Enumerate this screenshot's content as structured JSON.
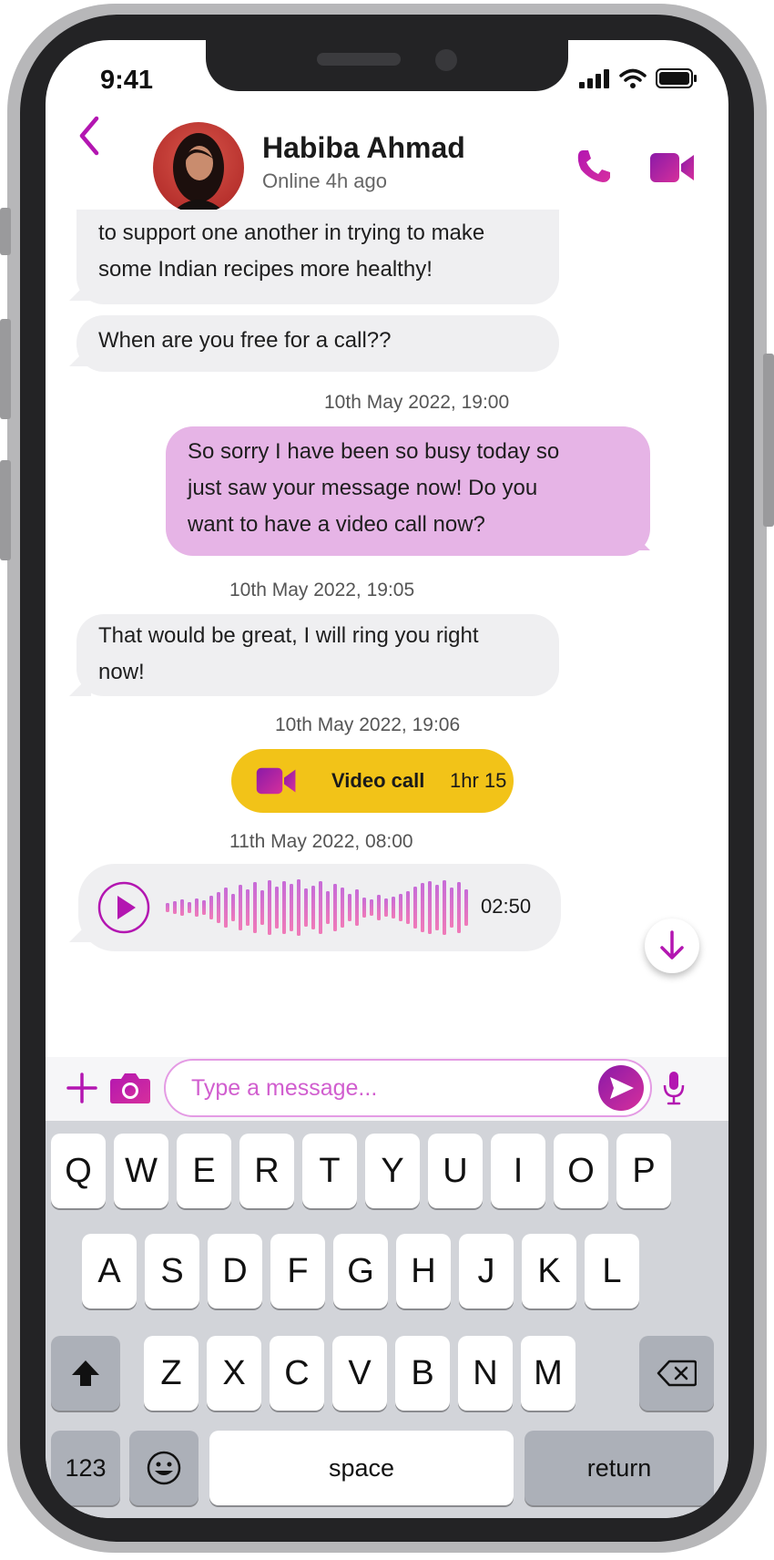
{
  "status_bar": {
    "time": "9:41"
  },
  "header": {
    "contact_name": "Habiba Ahmad",
    "contact_status": "Online 4h ago"
  },
  "messages": [
    {
      "direction": "incoming",
      "lines": [
        "to support one another in trying to make",
        "some Indian recipes more healthy!"
      ]
    },
    {
      "direction": "incoming",
      "lines": [
        "When are you free for a call??"
      ]
    },
    {
      "timestamp": "10th May 2022, 19:00"
    },
    {
      "direction": "outgoing",
      "lines": [
        "So sorry I have been so busy today so",
        "just saw your message now! Do you",
        "want to have a video call now?"
      ]
    },
    {
      "timestamp": "10th May 2022, 19:05"
    },
    {
      "direction": "incoming",
      "lines": [
        "That would be great, I will ring you right",
        "now!"
      ]
    },
    {
      "timestamp": "10th May 2022, 19:06"
    },
    {
      "call": {
        "label": "Video call",
        "duration": "1hr 15"
      }
    },
    {
      "timestamp": "11th May 2022, 08:00"
    },
    {
      "voice_note": {
        "duration": "02:50"
      }
    }
  ],
  "composer": {
    "placeholder": "Type a message..."
  },
  "keyboard": {
    "row1": [
      "Q",
      "W",
      "E",
      "R",
      "T",
      "Y",
      "U",
      "I",
      "O",
      "P"
    ],
    "row2": [
      "A",
      "S",
      "D",
      "F",
      "G",
      "H",
      "J",
      "K",
      "L"
    ],
    "row3": [
      "Z",
      "X",
      "C",
      "V",
      "B",
      "N",
      "M"
    ],
    "numbers_label": "123",
    "space_label": "space",
    "return_label": "return"
  },
  "colors": {
    "accent_purple": "#b316b1",
    "outgoing_bubble": "#e6b4e6",
    "incoming_bubble": "#efeff1",
    "call_pill": "#f2c318"
  },
  "icons": [
    "back-chevron-icon",
    "phone-icon",
    "video-camera-icon",
    "play-icon",
    "waveform-icon",
    "arrow-down-icon",
    "plus-icon",
    "camera-icon",
    "send-icon",
    "microphone-icon",
    "shift-icon",
    "backspace-icon",
    "emoji-icon"
  ]
}
